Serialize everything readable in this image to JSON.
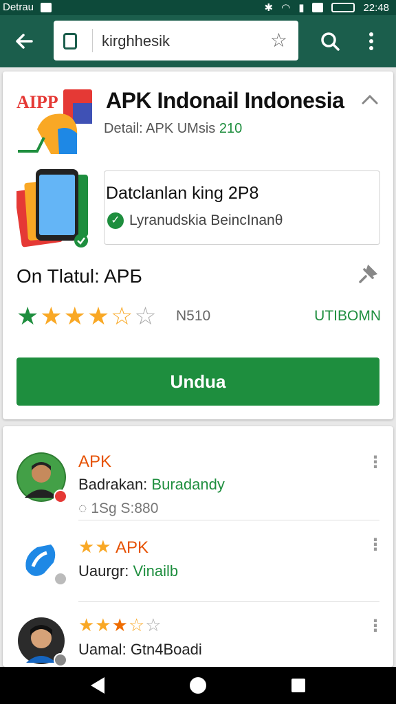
{
  "status_bar": {
    "carrier": "Detrau",
    "time": "22:48"
  },
  "app_bar": {
    "url": "kirghhesik"
  },
  "app_card": {
    "logo_text": "AIPP",
    "title": "APK Indonail Indonesia",
    "detail_prefix": "Detail: APK UMsis",
    "detail_version": "210",
    "info_title": "Datclanlan king 2P8",
    "verified_text": "Lyranudskia BeincInanθ",
    "subtitle": "On Tlatul: APБ",
    "rating_value": 4.5,
    "rating_count": "N510",
    "rating_action": "UTIBOMN",
    "download_label": "Undua",
    "accent_color": "#1e8e3e"
  },
  "list": [
    {
      "title": "APK",
      "sub_prefix": "Badrakan:",
      "sub_value": "Buradandy",
      "meta": "◌ 1Sg S:880",
      "stars": 0
    },
    {
      "title": "APK",
      "sub_prefix": "Uaurgr:",
      "sub_value": "Vinailb",
      "meta": "",
      "stars": 2
    },
    {
      "title": "",
      "sub_prefix": "Uamal:",
      "sub_value": "Gtn4Boadi",
      "meta": "",
      "stars": 3.5
    }
  ],
  "icons": {
    "back": "arrow-left-icon",
    "page": "page-icon",
    "bookmark": "star-outline-icon",
    "search": "search-icon",
    "more": "more-vert-icon",
    "collapse": "chevron-up-icon",
    "pin": "pin-icon",
    "verified": "check-circle-icon"
  }
}
